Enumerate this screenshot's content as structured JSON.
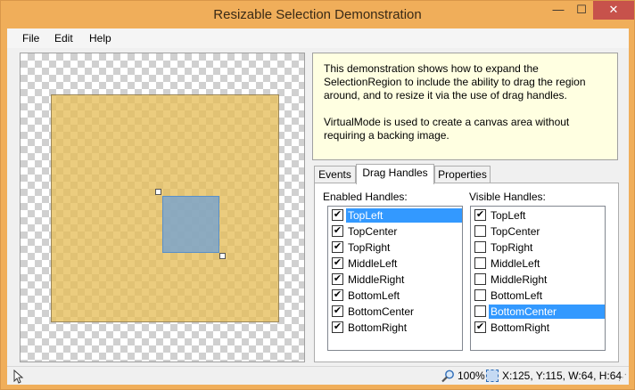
{
  "window": {
    "title": "Resizable Selection Demonstration",
    "minimize_glyph": "—",
    "maximize_glyph": "☐",
    "close_glyph": "✕"
  },
  "menu": {
    "items": [
      "File",
      "Edit",
      "Help"
    ]
  },
  "description": {
    "paragraph1": "This demonstration shows how to expand the SelectionRegion to include the ability to drag the region around, and to resize it via the use of drag handles.",
    "paragraph2": "VirtualMode is used to create a canvas area without requiring a backing image."
  },
  "tabs": {
    "items": [
      "Events",
      "Drag Handles",
      "Properties"
    ],
    "active": "Drag Handles"
  },
  "enabled_handles": {
    "label": "Enabled Handles:",
    "items": [
      {
        "label": "TopLeft",
        "checked": true,
        "selected": true
      },
      {
        "label": "TopCenter",
        "checked": true,
        "selected": false
      },
      {
        "label": "TopRight",
        "checked": true,
        "selected": false
      },
      {
        "label": "MiddleLeft",
        "checked": true,
        "selected": false
      },
      {
        "label": "MiddleRight",
        "checked": true,
        "selected": false
      },
      {
        "label": "BottomLeft",
        "checked": true,
        "selected": false
      },
      {
        "label": "BottomCenter",
        "checked": true,
        "selected": false
      },
      {
        "label": "BottomRight",
        "checked": true,
        "selected": false
      }
    ]
  },
  "visible_handles": {
    "label": "Visible Handles:",
    "items": [
      {
        "label": "TopLeft",
        "checked": true,
        "selected": false
      },
      {
        "label": "TopCenter",
        "checked": false,
        "selected": false
      },
      {
        "label": "TopRight",
        "checked": false,
        "selected": false
      },
      {
        "label": "MiddleLeft",
        "checked": false,
        "selected": false
      },
      {
        "label": "MiddleRight",
        "checked": false,
        "selected": false
      },
      {
        "label": "BottomLeft",
        "checked": false,
        "selected": false
      },
      {
        "label": "BottomCenter",
        "checked": false,
        "selected": true
      },
      {
        "label": "BottomRight",
        "checked": true,
        "selected": false
      }
    ]
  },
  "status": {
    "zoom": "100%",
    "selection": "X:125, Y:115, W:64, H:64",
    "icons": [
      "cursor-icon",
      "zoom-icon",
      "selection-icon"
    ]
  },
  "colors": {
    "titlebar": "#f0ae5a",
    "close_button": "#c7524b",
    "selection_fill": "#6ea0d7",
    "list_highlight": "#3399ff",
    "description_bg": "#ffffe1"
  }
}
